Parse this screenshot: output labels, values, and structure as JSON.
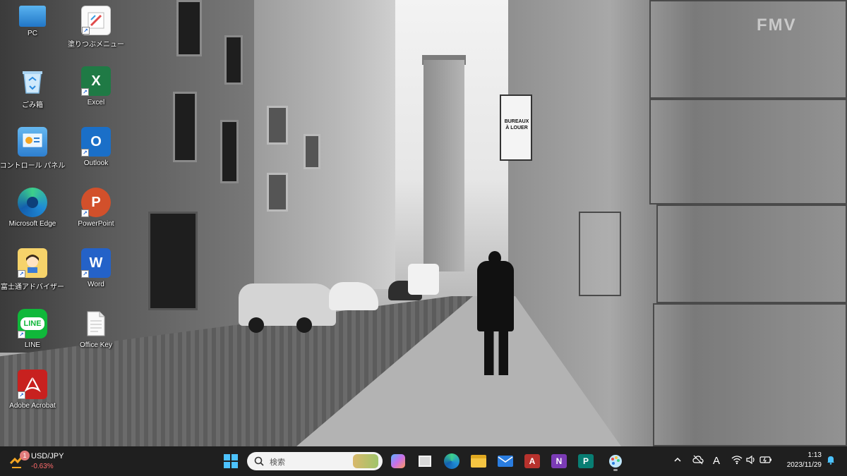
{
  "watermark": "FMV",
  "wallpaper_sign": "BUREAUX À LOUER",
  "desktop_icons": [
    {
      "id": "pc",
      "label": "PC",
      "icon": "computer-icon",
      "color": "#3a9de0"
    },
    {
      "id": "nurikome",
      "label": "塗りつぶメニュー",
      "icon": "paint-menu-icon",
      "color": "#ffffff"
    },
    {
      "id": "recycle",
      "label": "ごみ箱",
      "icon": "recycle-bin-icon",
      "color": "#9fd0f5"
    },
    {
      "id": "excel",
      "label": "Excel",
      "icon": "excel-icon",
      "color": "#1f7a45",
      "glyph": "X"
    },
    {
      "id": "control",
      "label": "コントロール パネル",
      "icon": "control-panel-icon",
      "color": "#3d8fe0"
    },
    {
      "id": "outlook",
      "label": "Outlook",
      "icon": "outlook-icon",
      "color": "#1a6fc8",
      "glyph": "O"
    },
    {
      "id": "edge",
      "label": "Microsoft Edge",
      "icon": "edge-icon",
      "color": "#1f8ad6"
    },
    {
      "id": "powerpoint",
      "label": "PowerPoint",
      "icon": "powerpoint-icon",
      "color": "#d2502b",
      "glyph": "P"
    },
    {
      "id": "advisor",
      "label": "富士通アドバイザー",
      "icon": "fujitsu-advisor-icon",
      "color": "#f0c040"
    },
    {
      "id": "word",
      "label": "Word",
      "icon": "word-icon",
      "color": "#2462c8",
      "glyph": "W"
    },
    {
      "id": "line",
      "label": "LINE",
      "icon": "line-icon",
      "color": "#10b83a",
      "glyph": "LINE"
    },
    {
      "id": "officekey",
      "label": "Office Key",
      "icon": "document-icon",
      "color": "#f4f4f4"
    },
    {
      "id": "acrobat",
      "label": "Adobe Acrobat",
      "icon": "acrobat-icon",
      "color": "#c8211f"
    }
  ],
  "taskbar": {
    "widget": {
      "badge": "1",
      "ticker": "USD/JPY",
      "change": "-0.63%"
    },
    "search_placeholder": "検索",
    "apps": [
      {
        "id": "start",
        "icon": "windows-start-icon",
        "color": "#4cc2ff"
      },
      {
        "id": "copilot",
        "icon": "copilot-icon",
        "color": "#c86fe8"
      },
      {
        "id": "taskview",
        "icon": "task-view-icon",
        "color": "#d0d0d0"
      },
      {
        "id": "edge",
        "icon": "edge-icon",
        "color": "#1f8ad6"
      },
      {
        "id": "explorer",
        "icon": "file-explorer-icon",
        "color": "#f5c542"
      },
      {
        "id": "mail",
        "icon": "mail-icon",
        "color": "#2a7de0"
      },
      {
        "id": "access",
        "icon": "access-icon",
        "color": "#b7322d"
      },
      {
        "id": "onenote",
        "icon": "onenote-icon",
        "color": "#7b3bb5"
      },
      {
        "id": "publisher",
        "icon": "publisher-icon",
        "color": "#087e73"
      },
      {
        "id": "paint",
        "icon": "paint-icon",
        "color": "#8fd0f0"
      }
    ],
    "tray": {
      "ime": "A",
      "time": "1:13",
      "date": "2023/11/29"
    }
  }
}
